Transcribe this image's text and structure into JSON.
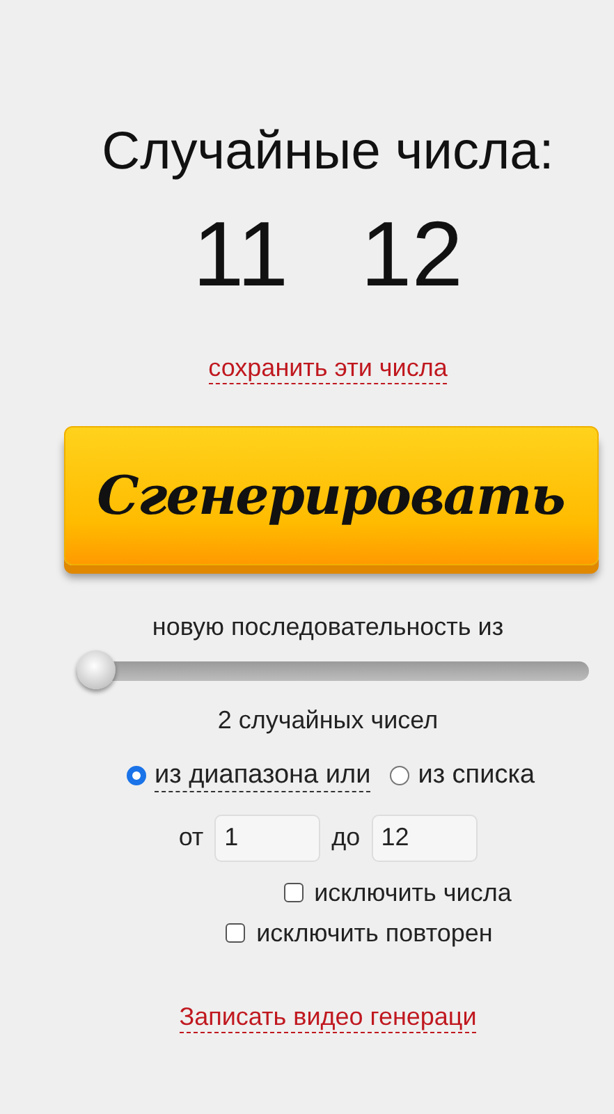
{
  "title": "Случайные числа:",
  "numbers": [
    "11",
    "12"
  ],
  "save_link": "сохранить эти числа",
  "generate_button": "Сгенерировать",
  "sequence_label": "новую последовательность из",
  "count_slider": {
    "level": 0
  },
  "count_label": "2 случайных чисел",
  "source_options": [
    {
      "label": "из диапазона или",
      "selected": true,
      "dashed": true
    },
    {
      "label": "из списка",
      "selected": false,
      "dashed": false
    }
  ],
  "range": {
    "from_label": "от",
    "from_value": "1",
    "to_label": "до",
    "to_value": "12"
  },
  "checkboxes": [
    {
      "label": "исключить числа",
      "checked": false
    },
    {
      "label": "исключить повторен",
      "checked": false
    }
  ],
  "video_link": "Записать видео генераци"
}
